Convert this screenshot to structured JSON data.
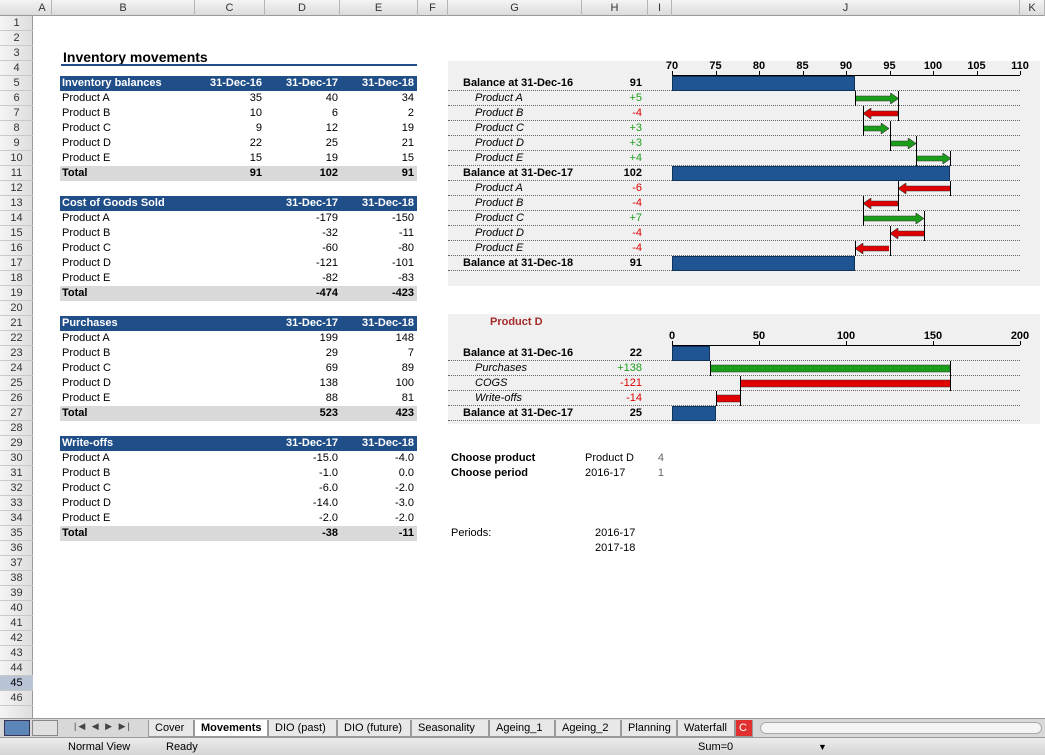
{
  "columns": [
    "A",
    "B",
    "C",
    "D",
    "E",
    "F",
    "G",
    "H",
    "I",
    "J",
    "K"
  ],
  "rows": [
    "1",
    "2",
    "3",
    "4",
    "5",
    "6",
    "7",
    "8",
    "9",
    "10",
    "11",
    "12",
    "13",
    "14",
    "15",
    "16",
    "17",
    "18",
    "19",
    "20",
    "21",
    "22",
    "23",
    "24",
    "25",
    "26",
    "27",
    "28",
    "29",
    "30",
    "31",
    "32",
    "33",
    "34",
    "35",
    "36",
    "37",
    "38",
    "39",
    "40",
    "41",
    "42",
    "43",
    "44",
    "45",
    "46"
  ],
  "title": "Inventory movements",
  "balances": {
    "header": "Inventory balances",
    "cols": [
      "31-Dec-16",
      "31-Dec-17",
      "31-Dec-18"
    ],
    "rows": [
      [
        "Product A",
        "35",
        "40",
        "34"
      ],
      [
        "Product B",
        "10",
        "6",
        "2"
      ],
      [
        "Product C",
        "9",
        "12",
        "19"
      ],
      [
        "Product D",
        "22",
        "25",
        "21"
      ],
      [
        "Product E",
        "15",
        "19",
        "15"
      ]
    ],
    "total": [
      "Total",
      "91",
      "102",
      "91"
    ]
  },
  "cogs": {
    "header": "Cost of Goods Sold",
    "cols": [
      "31-Dec-17",
      "31-Dec-18"
    ],
    "rows": [
      [
        "Product A",
        "-179",
        "-150"
      ],
      [
        "Product B",
        "-32",
        "-11"
      ],
      [
        "Product C",
        "-60",
        "-80"
      ],
      [
        "Product D",
        "-121",
        "-101"
      ],
      [
        "Product E",
        "-82",
        "-83"
      ]
    ],
    "total": [
      "Total",
      "-474",
      "-423"
    ]
  },
  "purchases": {
    "header": "Purchases",
    "cols": [
      "31-Dec-17",
      "31-Dec-18"
    ],
    "rows": [
      [
        "Product A",
        "199",
        "148"
      ],
      [
        "Product B",
        "29",
        "7"
      ],
      [
        "Product C",
        "69",
        "89"
      ],
      [
        "Product D",
        "138",
        "100"
      ],
      [
        "Product E",
        "88",
        "81"
      ]
    ],
    "total": [
      "Total",
      "523",
      "423"
    ]
  },
  "writeoffs": {
    "header": "Write-offs",
    "cols": [
      "31-Dec-17",
      "31-Dec-18"
    ],
    "rows": [
      [
        "Product A",
        "-15.0",
        "-4.0"
      ],
      [
        "Product B",
        "-1.0",
        "0.0"
      ],
      [
        "Product C",
        "-6.0",
        "-2.0"
      ],
      [
        "Product D",
        "-14.0",
        "-3.0"
      ],
      [
        "Product E",
        "-2.0",
        "-2.0"
      ]
    ],
    "total": [
      "Total",
      "-38",
      "-11"
    ]
  },
  "controls": {
    "choose_product_label": "Choose product",
    "choose_product_value": "Product D",
    "choose_product_index": "4",
    "choose_period_label": "Choose period",
    "choose_period_value": "2016-17",
    "choose_period_index": "1",
    "periods_label": "Periods:",
    "periods": [
      "2016-17",
      "2017-18"
    ]
  },
  "chart_data": [
    {
      "type": "bar",
      "subtype": "waterfall",
      "xlim": [
        70,
        110
      ],
      "xticks": [
        "70",
        "75",
        "80",
        "85",
        "90",
        "95",
        "100",
        "105",
        "110"
      ],
      "categories": [
        "Balance at 31-Dec-16",
        "Product A",
        "Product B",
        "Product C",
        "Product D",
        "Product E",
        "Balance at 31-Dec-17",
        "Product A",
        "Product B",
        "Product C",
        "Product D",
        "Product E",
        "Balance at 31-Dec-18"
      ],
      "labels": [
        "91",
        "+5",
        "-4",
        "+3",
        "+3",
        "+4",
        "102",
        "-6",
        "-4",
        "+7",
        "-4",
        "-4",
        "91"
      ],
      "values": [
        91,
        5,
        -4,
        3,
        3,
        4,
        102,
        -6,
        -4,
        7,
        -4,
        -4,
        91
      ],
      "kinds": [
        "total",
        "delta",
        "delta",
        "delta",
        "delta",
        "delta",
        "total",
        "delta",
        "delta",
        "delta",
        "delta",
        "delta",
        "total"
      ],
      "colors": {
        "total": "#1f5592",
        "up": "#1a9e1a",
        "down": "#e00000"
      }
    },
    {
      "type": "bar",
      "subtype": "waterfall",
      "title": "Product D",
      "xlim": [
        0,
        200
      ],
      "xticks": [
        "0",
        "50",
        "100",
        "150",
        "200"
      ],
      "categories": [
        "Balance at 31-Dec-16",
        "Purchases",
        "COGS",
        "Write-offs",
        "Balance at 31-Dec-17"
      ],
      "labels": [
        "22",
        "+138",
        "-121",
        "-14",
        "25"
      ],
      "values": [
        22,
        138,
        -121,
        -14,
        25
      ],
      "kinds": [
        "total",
        "delta",
        "delta",
        "delta",
        "total"
      ],
      "colors": {
        "total": "#1f5592",
        "up": "#1a9e1a",
        "down": "#e00000"
      }
    }
  ],
  "sheet_tabs": [
    "Cover",
    "Movements",
    "DIO (past)",
    "DIO (future)",
    "Seasonality",
    "Ageing_1",
    "Ageing_2",
    "Planning",
    "Waterfall",
    "C"
  ],
  "active_tab": "Movements",
  "status": {
    "view": "Normal View",
    "ready": "Ready",
    "sum": "Sum=0"
  }
}
